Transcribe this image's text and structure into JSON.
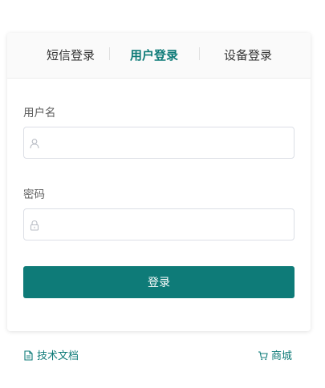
{
  "tabs": [
    {
      "label": "短信登录",
      "active": false
    },
    {
      "label": "用户登录",
      "active": true
    },
    {
      "label": "设备登录",
      "active": false
    }
  ],
  "form": {
    "username_label": "用户名",
    "username_value": "",
    "password_label": "密码",
    "password_value": "",
    "submit_label": "登录"
  },
  "footer": {
    "docs_label": "技术文档",
    "shop_label": "商城"
  },
  "colors": {
    "accent": "#0e7b78"
  },
  "icons": {
    "username": "user-icon",
    "password": "lock-icon",
    "docs": "document-icon",
    "shop": "cart-icon"
  }
}
